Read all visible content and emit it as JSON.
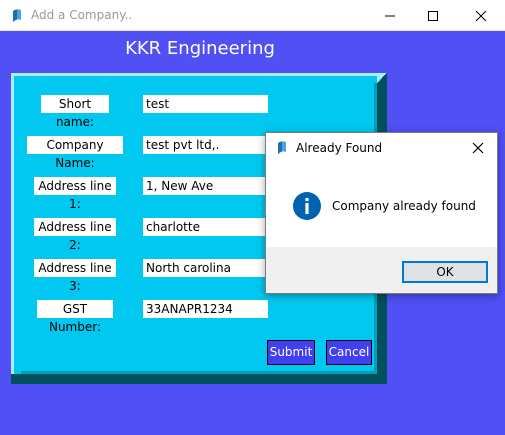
{
  "window": {
    "title": "Add a Company..",
    "heading": "KKR Engineering"
  },
  "form": {
    "fields": [
      {
        "label": "Short name:",
        "value": "test"
      },
      {
        "label": "Company Name:",
        "value": "test pvt ltd,."
      },
      {
        "label": "Address line 1:",
        "value": "1, New Ave"
      },
      {
        "label": "Address line 2:",
        "value": "charlotte"
      },
      {
        "label": "Address line 3:",
        "value": "North carolina"
      },
      {
        "label": "GST Number:",
        "value": "33ANAPR1234"
      }
    ],
    "submit_label": "Submit",
    "cancel_label": "Cancel"
  },
  "dialog": {
    "title": "Already Found",
    "message": "Company already found",
    "ok_label": "OK"
  },
  "icons": {
    "app": "feather-app-icon",
    "minimize": "minimize-icon",
    "maximize": "maximize-icon",
    "close": "close-icon",
    "info": "info-icon"
  },
  "colors": {
    "window_bg": "#5050f5",
    "panel_bg": "#00c8f0",
    "button_bg": "#4040f0",
    "info_blue": "#0063b1",
    "ok_border": "#0078d7"
  }
}
